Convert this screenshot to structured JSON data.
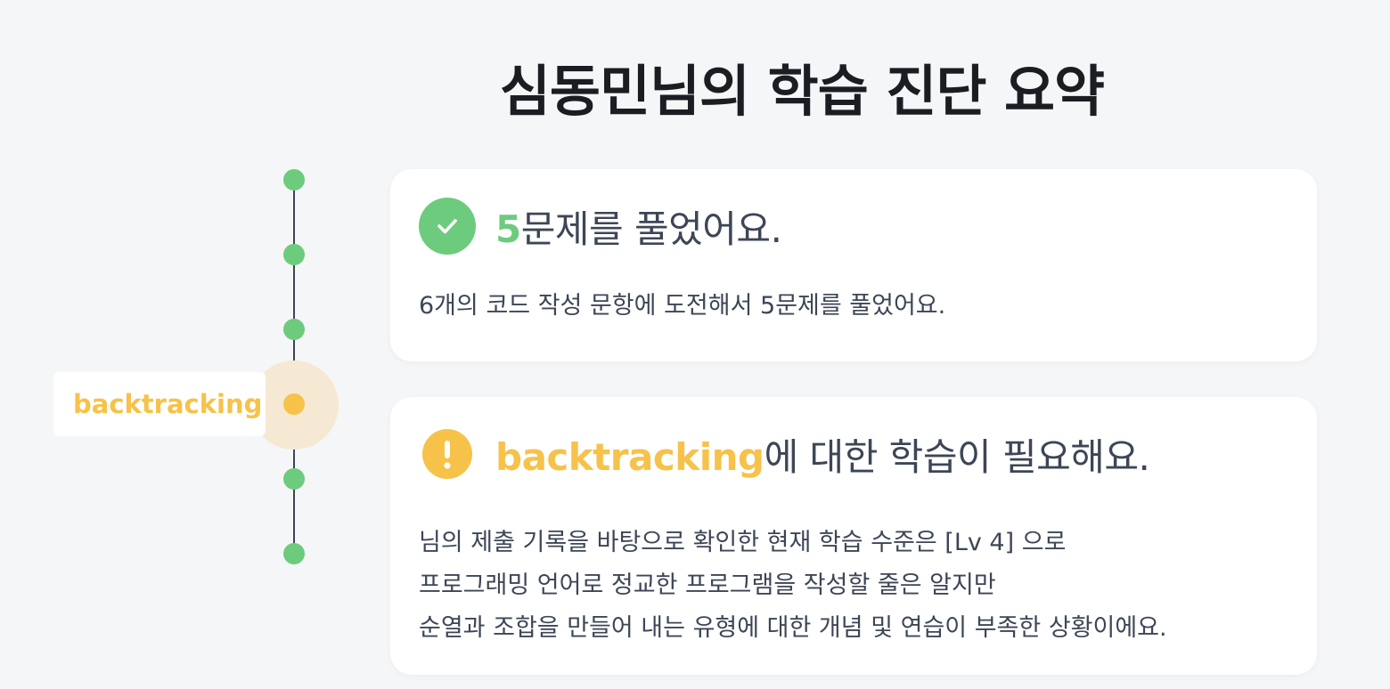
{
  "page": {
    "title": "심동민님의 학습 진단 요약"
  },
  "timeline": {
    "active_label": "backtracking",
    "colors": {
      "done": "#6dcb7e",
      "active": "#f6c24a",
      "line": "#3d4656"
    }
  },
  "solved_card": {
    "icon": "check-icon",
    "count": "5",
    "heading_suffix": "문제를 풀었어요.",
    "description": "6개의 코드 작성 문항에 도전해서 5문제를 풀었어요."
  },
  "weakness_card": {
    "icon": "exclamation-icon",
    "topic": "backtracking",
    "heading_suffix": "에 대한 학습이 필요해요.",
    "lines": [
      "님의 제출 기록을 바탕으로 확인한 현재 학습 수준은 [Lv 4] 으로",
      "프로그래밍 언어로 정교한 프로그램을 작성할 줄은 알지만",
      "순열과 조합을 만들어 내는 유형에 대한 개념 및 연습이 부족한 상황이에요."
    ]
  }
}
